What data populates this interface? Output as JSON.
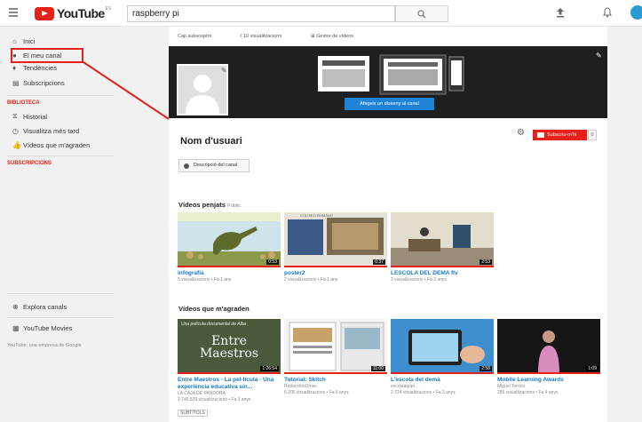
{
  "header": {
    "logo_text": "YouTube",
    "logo_country": "ES",
    "search_value": "raspberry pi"
  },
  "sidebar": {
    "items": [
      {
        "label": "Inici",
        "icon": "home-icon"
      },
      {
        "label": "El meu canal",
        "icon": "user-icon"
      },
      {
        "label": "Tendències",
        "icon": "flame-icon"
      },
      {
        "label": "Subscripcions",
        "icon": "subscriptions-icon"
      }
    ],
    "library_heading": "BIBLIOTECA",
    "library_items": [
      {
        "label": "Historial",
        "icon": "hourglass-icon"
      },
      {
        "label": "Visualitza més tard",
        "icon": "clock-icon"
      },
      {
        "label": "Vídeos que m'agraden",
        "icon": "thumbs-up-icon"
      }
    ],
    "subscriptions_heading": "SUBSCRIPCIONS",
    "explore_label": "Explora canals",
    "movies_label": "YouTube Movies",
    "footer_text": "YouTube, una empresa de Google"
  },
  "channel": {
    "tabs": [
      {
        "label": "Cap subscriptor"
      },
      {
        "label": "10 visualitzacions"
      },
      {
        "label": "Gestor de vídeos"
      }
    ],
    "banner_button": "Afegeix un disseny al canal",
    "username": "Nom d'usuari",
    "subscribe_label": "Subscriu-m'hi",
    "subscribe_count": "0",
    "description_button": "Descripció del canal"
  },
  "uploads": {
    "title": "Vídeos penjats",
    "privacy": "Públic",
    "videos": [
      {
        "title": "infografia",
        "meta": "5 visualitzacions • Fa 1 any",
        "duration": "0:53"
      },
      {
        "title": "poster2",
        "meta": "2 visualitzacions • Fa 1 any",
        "duration": "0:37",
        "thumb_text": "COLISEO ROMANO"
      },
      {
        "title": "LESCOLA DEL DEMA flv",
        "meta": "3 visualitzacions • Fa 3 anys",
        "duration": "2:53"
      }
    ]
  },
  "liked": {
    "title": "Vídeos que m'agraden",
    "videos": [
      {
        "title": "Entre Maestros - La pel·lícula - Una experiència educativa sin...",
        "channel": "LA CAJA DE PANDORA",
        "meta": "2.746.839 visualitzacions • Fa 3 anys",
        "duration": "1:26:54",
        "thumb_caption": "Una película documental de Alba",
        "thumb_title": "Entre Maestros",
        "tag": "SUBTÍTOLS"
      },
      {
        "title": "Tutorial: Skitch",
        "channel": "RedaccionOmac",
        "meta": "6.205 visualitzacions • Fa 6 anys",
        "duration": "11:00"
      },
      {
        "title": "L'escola del demà",
        "channel": "escolaaqupr",
        "meta": "2.724 visualitzacions • Fa 3 anys",
        "duration": "2:58"
      },
      {
        "title": "Mobile Learning Awards",
        "channel": "Miguel Torrico",
        "meta": "285 visualitzacions • Fa 4 anys",
        "duration": "1:09"
      }
    ]
  },
  "colors": {
    "brand": "#e62117",
    "link": "#167ac6",
    "banner_button": "#1f84d8"
  }
}
